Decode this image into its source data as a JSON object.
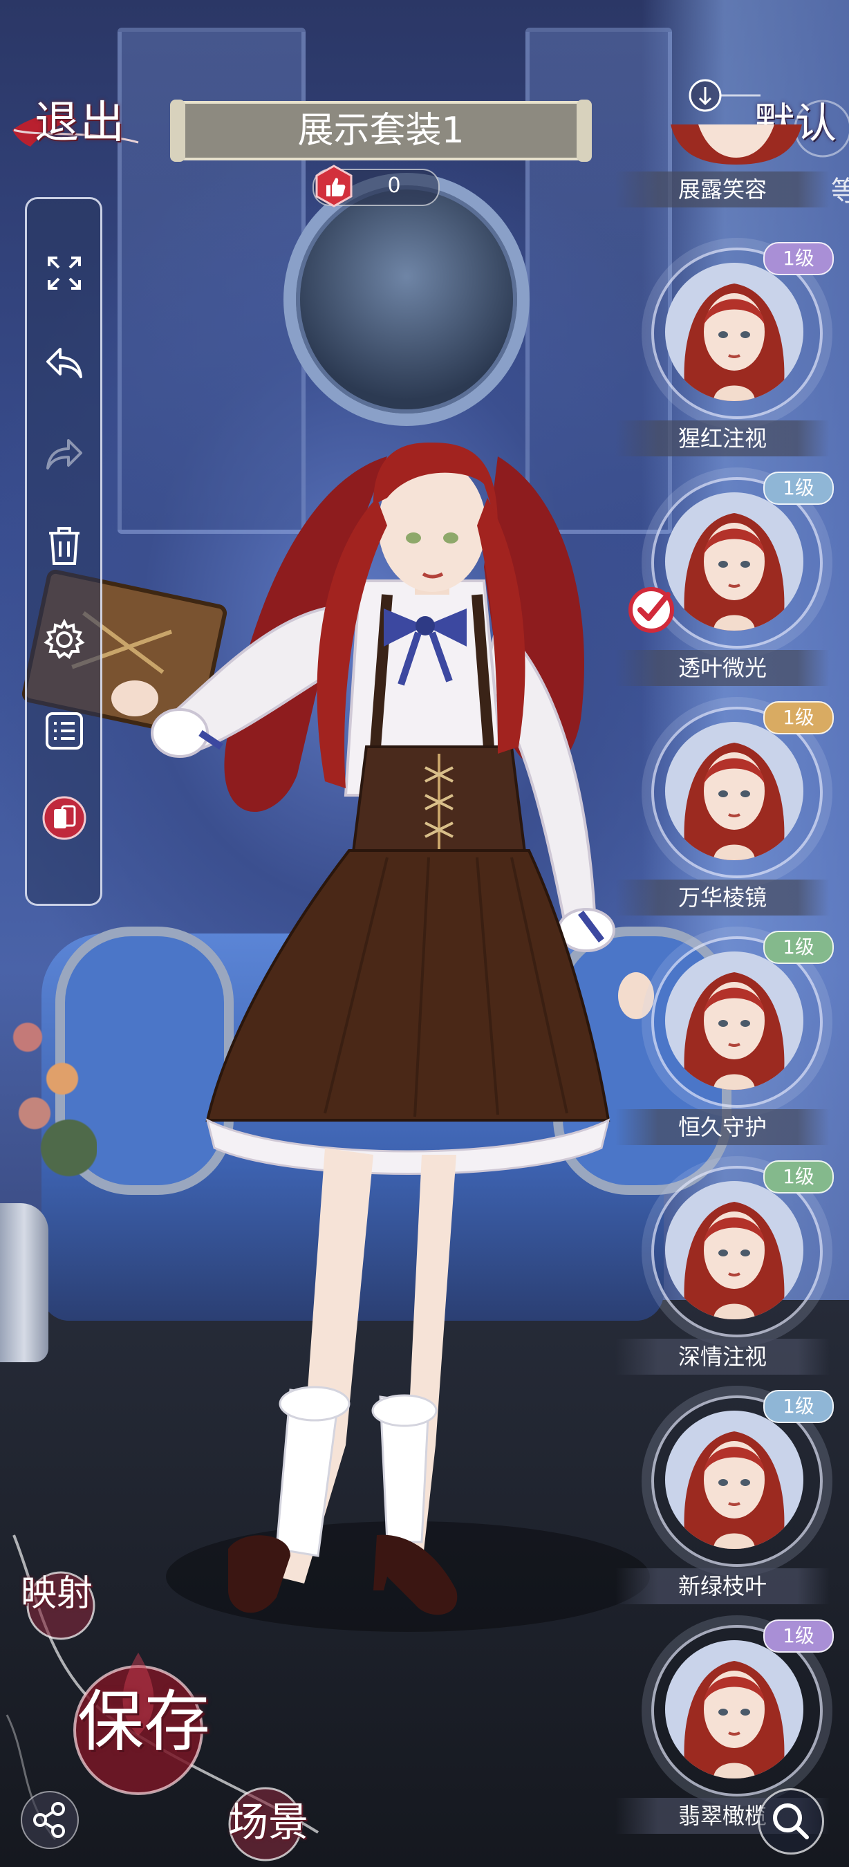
{
  "top_bar": {
    "exit_label": "退出",
    "outfit_title": "展示套装1",
    "like_count": "0"
  },
  "right_panel": {
    "default_label": "默认",
    "partial_item": "展露笑容",
    "partial_item_side_glyph": "等",
    "looks": [
      {
        "name": "猩红注视",
        "level": "1级",
        "badge_color": "#a98fd6"
      },
      {
        "name": "透叶微光",
        "level": "1级",
        "badge_color": "#8fb6d6",
        "selected": true
      },
      {
        "name": "万华棱镜",
        "level": "1级",
        "badge_color": "#d9ab62"
      },
      {
        "name": "恒久守护",
        "level": "1级",
        "badge_color": "#84b98c"
      },
      {
        "name": "深情注视",
        "level": "1级",
        "badge_color": "#84b98c"
      },
      {
        "name": "新绿枝叶",
        "level": "1级",
        "badge_color": "#8fb6d6"
      },
      {
        "name": "翡翠橄榄",
        "level": "1级",
        "badge_color": "#a98fd6"
      }
    ]
  },
  "left_tools": [
    {
      "name": "fullscreen-icon"
    },
    {
      "name": "undo-icon"
    },
    {
      "name": "redo-icon"
    },
    {
      "name": "trash-icon"
    },
    {
      "name": "gear-icon"
    },
    {
      "name": "list-icon"
    },
    {
      "name": "outfit-swap-icon"
    }
  ],
  "bottom": {
    "mirror_label": "映射",
    "save_label": "保存",
    "scene_label": "场景"
  },
  "colors": {
    "accent_red": "#c0283c",
    "panel_border": "#e6ebfa"
  }
}
